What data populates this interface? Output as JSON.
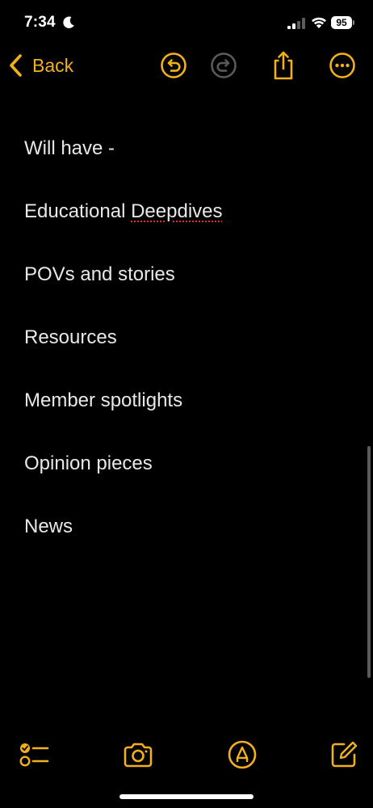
{
  "status_bar": {
    "time": "7:34",
    "battery": "95",
    "icons": [
      "moon-icon",
      "signal-icon",
      "wifi-icon",
      "battery-icon"
    ]
  },
  "nav": {
    "back_label": "Back",
    "icons": [
      "chevron-left-icon",
      "undo-icon",
      "redo-icon",
      "share-icon",
      "more-icon"
    ]
  },
  "note": {
    "lines": [
      {
        "text": "Will have -"
      },
      {
        "prefix": "Educational ",
        "misspelled": "Deepdives"
      },
      {
        "text": "POVs and stories"
      },
      {
        "text": "Resources"
      },
      {
        "text": "Member spotlights"
      },
      {
        "text": "Opinion pieces"
      },
      {
        "text": "News"
      }
    ]
  },
  "toolbar": {
    "icons": [
      "checklist-icon",
      "camera-icon",
      "markup-icon",
      "compose-icon"
    ]
  },
  "colors": {
    "accent": "#f2b01c",
    "background": "#000000",
    "text": "#e8e8e8",
    "disabled": "#5a5a5a",
    "spellcheck": "#e03030"
  }
}
